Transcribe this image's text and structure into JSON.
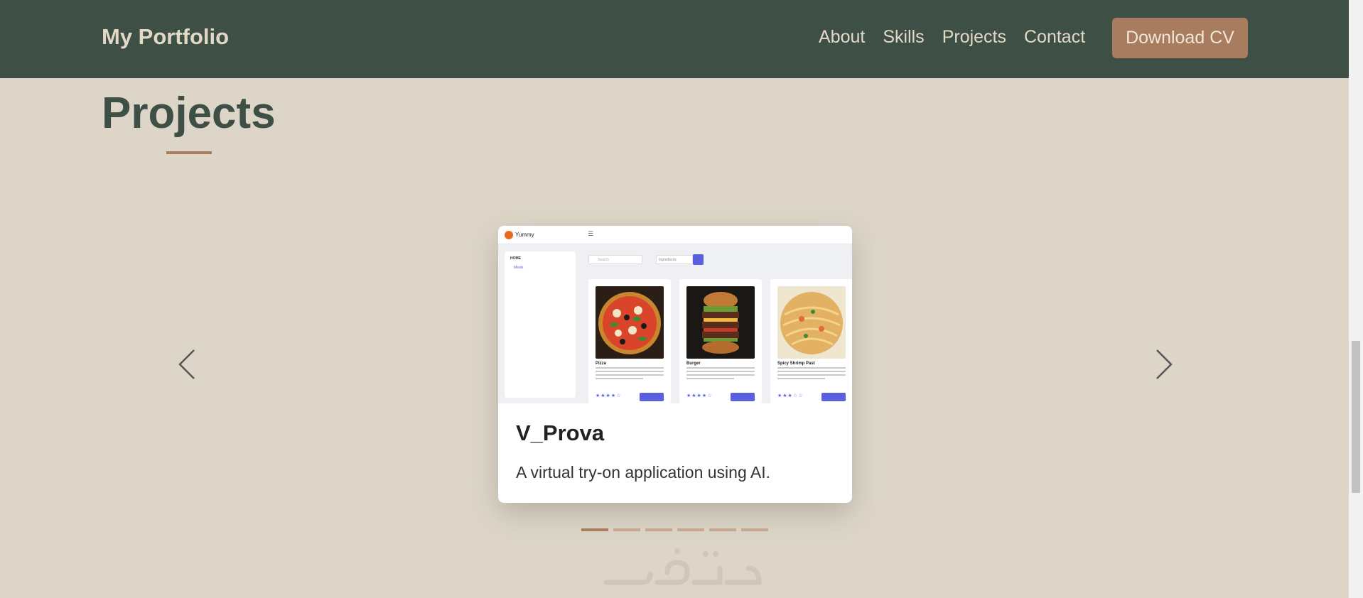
{
  "header": {
    "brand": "My Portfolio",
    "nav": [
      "About",
      "Skills",
      "Projects",
      "Contact"
    ],
    "cta_label": "Download CV"
  },
  "section": {
    "title": "Projects"
  },
  "carousel": {
    "active_index": 0,
    "slide_count": 6,
    "slide": {
      "title": "V_Prova",
      "description": "A virtual try-on application using AI.",
      "screenshot": {
        "app_name": "Yummy",
        "sidebar_heading": "HOME",
        "sidebar_item": "Meals",
        "search_placeholder": "Search",
        "filter_placeholder": "Ingredients",
        "cards": [
          {
            "name": "Pizza",
            "stars": "★★★★☆"
          },
          {
            "name": "Burger",
            "stars": "★★★★☆"
          },
          {
            "name": "Spicy Shrimp Past",
            "stars": "★★★☆☆"
          }
        ]
      }
    }
  },
  "colors": {
    "header_bg": "#3e5046",
    "page_bg": "#ddd6c8",
    "accent": "#a87c5e",
    "brand_text": "#e2d8c6"
  },
  "icons": [
    "chevron-left-icon",
    "chevron-right-icon",
    "hamburger-menu-icon"
  ]
}
